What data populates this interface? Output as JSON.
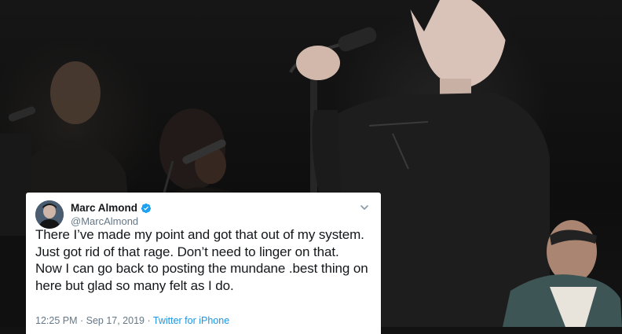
{
  "tweet": {
    "author_name": "Marc Almond",
    "author_handle": "@MarcAlmond",
    "verified": true,
    "text_lines": [
      "There I’ve made my point and got that out of my system.",
      "Just got rid of that rage. Don’t need to linger on that.",
      "Now I can go back to posting the mundane .best thing on",
      "here but glad so many felt as I do."
    ],
    "timestamp": "12:25 PM · Sep 17, 2019",
    "separator": " · ",
    "source": "Twitter for iPhone"
  },
  "colors": {
    "text_primary": "#14171a",
    "text_secondary": "#657786",
    "link_blue": "#1b95e0",
    "verified_blue": "#1da1f2"
  },
  "icons": {
    "verified": "verified-badge-icon",
    "menu": "chevron-down-icon"
  }
}
